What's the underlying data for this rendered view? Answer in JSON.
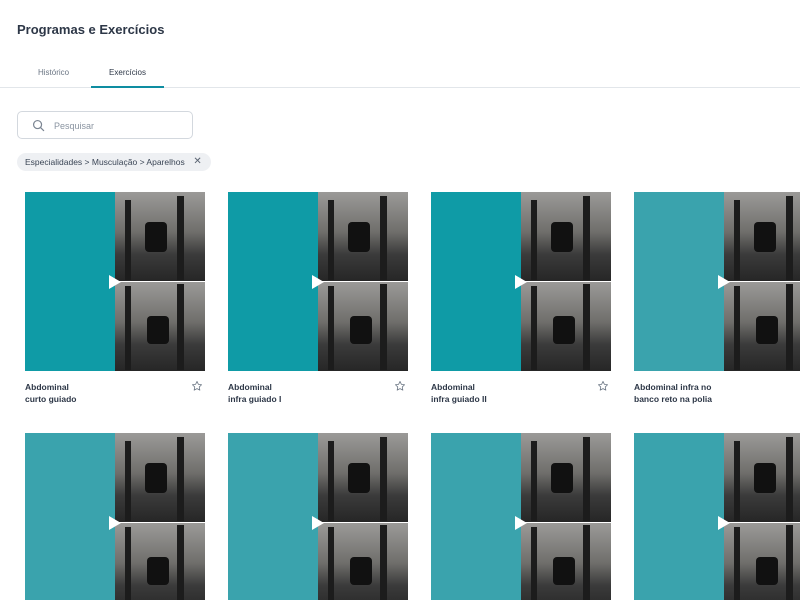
{
  "page": {
    "title": "Programas e Exercícios"
  },
  "tabs": [
    {
      "label": "Histórico",
      "active": false
    },
    {
      "label": "Exercícios",
      "active": true
    }
  ],
  "search": {
    "placeholder": "Pesquisar",
    "value": "",
    "icon": "search-icon"
  },
  "filter_chip": {
    "label": "Especialidades > Musculação > Aparelhos",
    "close_icon": "close-icon"
  },
  "colors": {
    "accent": "#0e8da1",
    "thumb_teal": "#0f9ba6",
    "thumb_teal_alt": "#3aa3ad"
  },
  "exercises": [
    {
      "line1": "Abdominal",
      "line2": "curto guiado",
      "favorite_icon": "star-icon"
    },
    {
      "line1": "Abdominal",
      "line2": "infra guiado I",
      "favorite_icon": "star-icon"
    },
    {
      "line1": "Abdominal",
      "line2": "infra guiado II",
      "favorite_icon": "star-icon"
    },
    {
      "line1": "Abdominal infra no",
      "line2": "banco reto na polia",
      "favorite_icon": "star-icon"
    },
    {
      "line1": "",
      "line2": "",
      "favorite_icon": "star-icon"
    },
    {
      "line1": "",
      "line2": "",
      "favorite_icon": "star-icon"
    },
    {
      "line1": "",
      "line2": "",
      "favorite_icon": "star-icon"
    },
    {
      "line1": "",
      "line2": "",
      "favorite_icon": "star-icon"
    }
  ]
}
